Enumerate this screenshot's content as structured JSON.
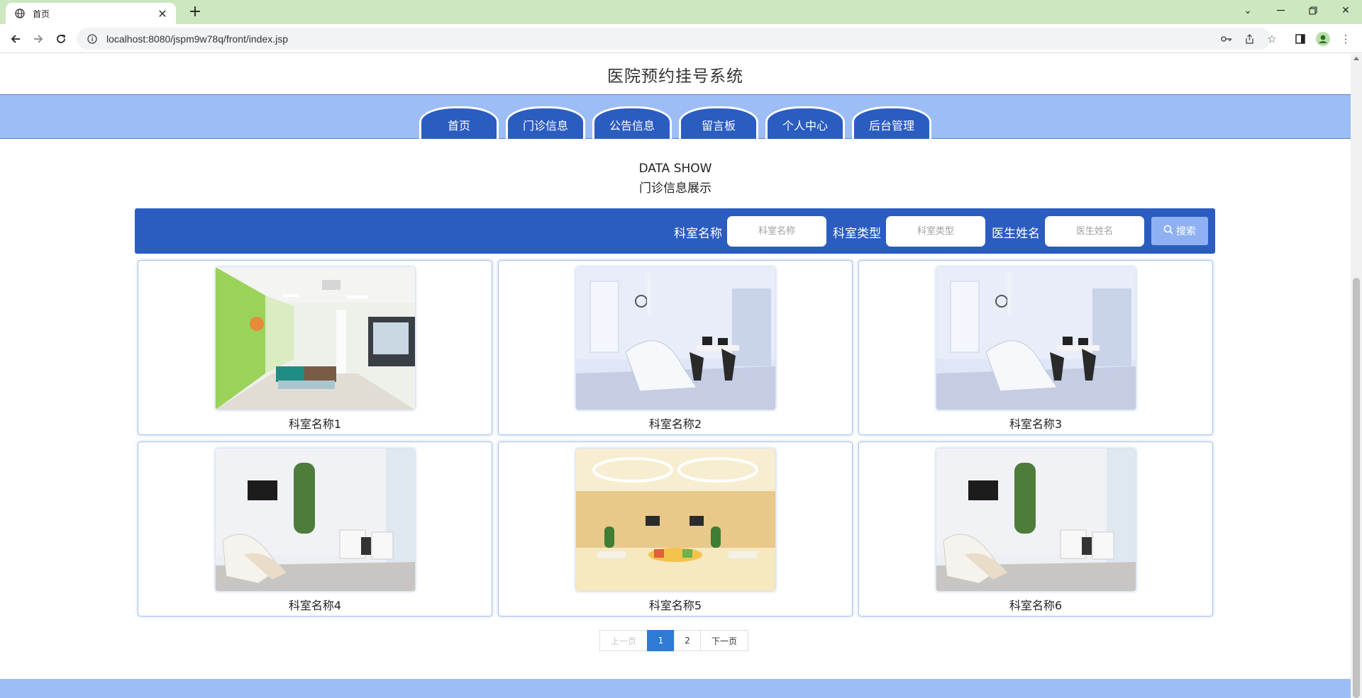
{
  "browser": {
    "tab_title": "首页",
    "url": "localhost:8080/jspm9w78q/front/index.jsp"
  },
  "site": {
    "title": "医院预约挂号系统"
  },
  "nav": {
    "items": [
      {
        "label": "首页"
      },
      {
        "label": "门诊信息"
      },
      {
        "label": "公告信息"
      },
      {
        "label": "留言板"
      },
      {
        "label": "个人中心"
      },
      {
        "label": "后台管理"
      }
    ]
  },
  "section": {
    "title_en": "DATA SHOW",
    "title_cn": "门诊信息展示"
  },
  "search": {
    "dept_name_label": "科室名称",
    "dept_name_placeholder": "科室名称",
    "dept_type_label": "科室类型",
    "dept_type_placeholder": "科室类型",
    "doctor_label": "医生姓名",
    "doctor_placeholder": "医生姓名",
    "button_label": "搜索"
  },
  "cards": [
    {
      "name": "科室名称1",
      "image": "lobby"
    },
    {
      "name": "科室名称2",
      "image": "dental-room"
    },
    {
      "name": "科室名称3",
      "image": "dental-room"
    },
    {
      "name": "科室名称4",
      "image": "dental-suite"
    },
    {
      "name": "科室名称5",
      "image": "waiting-hall"
    },
    {
      "name": "科室名称6",
      "image": "dental-suite"
    }
  ],
  "pagination": {
    "prev": "上一页",
    "pages": [
      "1",
      "2"
    ],
    "current": "1",
    "next": "下一页"
  },
  "colors": {
    "primary": "#2b5cc0",
    "nav_band": "#9dbdf6",
    "tabbar": "#cde8c0",
    "pager_active": "#2e7bd6"
  }
}
